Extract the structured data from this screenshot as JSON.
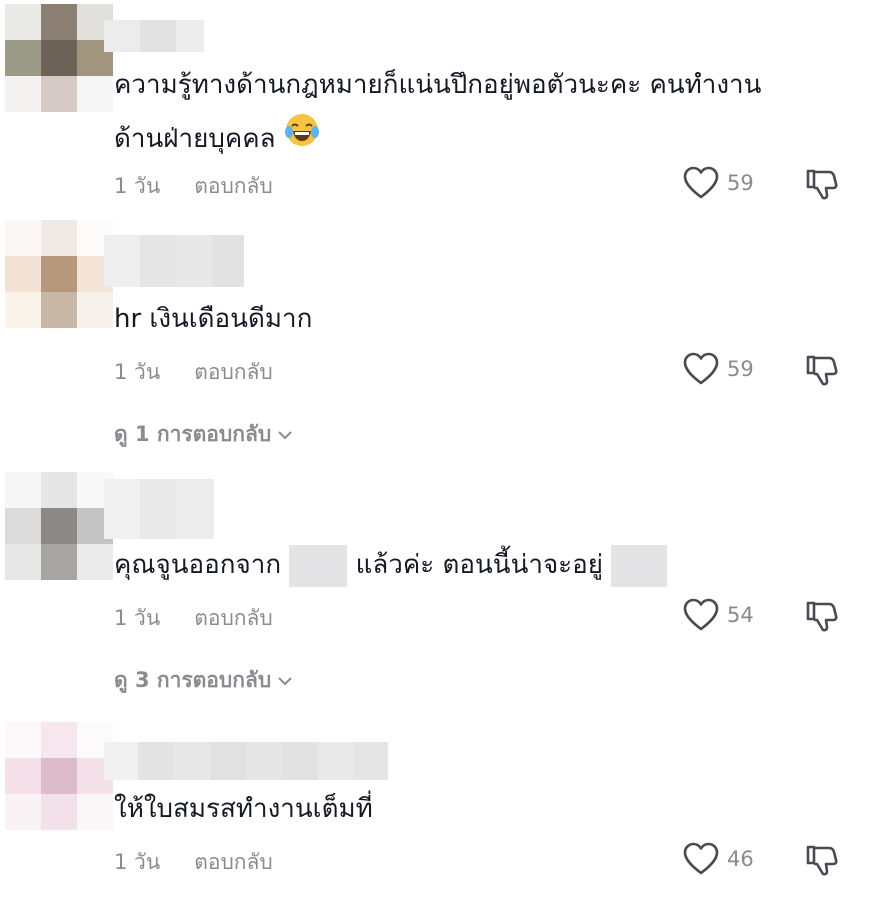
{
  "comments": [
    {
      "text_line1": "ความรู้ทางด้านกฎหมายก็แน่นปึกอยู่พอตัวนะคะ คนทำงาน",
      "text_line2": "ด้านฝ่ายบุคคล",
      "emoji": "laughing-crying-emoji",
      "time": "1 วัน",
      "reply": "ตอบกลับ",
      "likes": "59"
    },
    {
      "text": "hr เงินเดือนดีมาก",
      "time": "1 วัน",
      "reply": "ตอบกลับ",
      "likes": "59",
      "view_replies": "ดู 1 การตอบกลับ"
    },
    {
      "text_part1": "คุณจูนออกจาก",
      "text_part2": "แล้วค่ะ ตอนนี้น่าจะอยู่",
      "time": "1 วัน",
      "reply": "ตอบกลับ",
      "likes": "54",
      "view_replies": "ดู 3 การตอบกลับ"
    },
    {
      "text": "ให้ใบสมรสทำงานเต็มที่",
      "time": "1 วัน",
      "reply": "ตอบกลับ",
      "likes": "46"
    }
  ],
  "colors": {
    "text": "#161823",
    "secondary": "#8a8b91",
    "blur": "#e4e4e6"
  },
  "icons": {
    "like": "heart-outline-icon",
    "dislike": "thumbs-down-outline-icon",
    "expand": "chevron-down-icon"
  }
}
